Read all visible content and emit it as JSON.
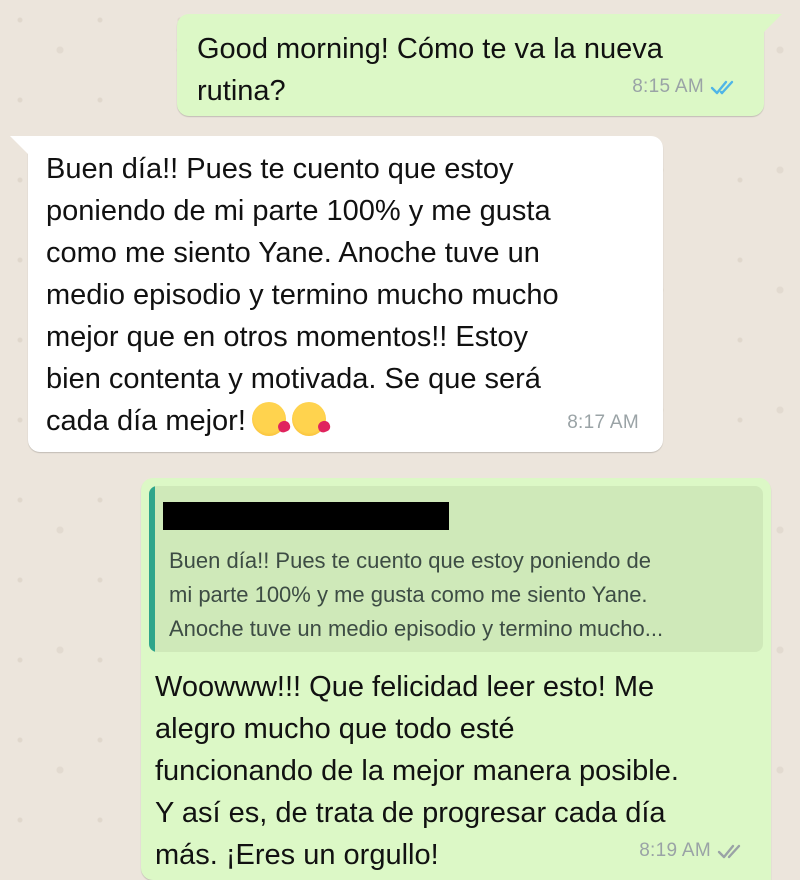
{
  "chat": {
    "messages": [
      {
        "direction": "outgoing",
        "text": "Good morning! Cómo te va la nueva\nrutina?",
        "time": "8:15 AM",
        "status_icon": "double-check-read-icon",
        "status_color": "#4fb5e7"
      },
      {
        "direction": "incoming",
        "text": "Buen día!! Pues te cuento que estoy\nponiendo de mi parte 100% y me gusta\ncomo me siento Yane. Anoche tuve un\nmedio episodio y termino mucho mucho\nmejor que en otros momentos!! Estoy\nbien contenta y motivada. Se que será\ncada día mejor!",
        "emoji_icons": [
          "face-blowing-kiss-icon",
          "face-blowing-kiss-icon"
        ],
        "time": "8:17 AM"
      },
      {
        "direction": "outgoing",
        "quote": {
          "author_redacted": true,
          "text": "Buen día!! Pues te cuento que estoy poniendo de\nmi parte 100% y me gusta como me siento Yane.\nAnoche tuve un medio episodio y termino mucho..."
        },
        "text": "Woowww!!! Que felicidad leer esto! Me\nalegro mucho que todo esté\nfuncionando de la mejor manera posible.\nY así es, de trata de progresar cada día\nmás. ¡Eres un orgullo!",
        "time": "8:19 AM",
        "status_icon": "double-check-delivered-icon",
        "status_color": "#9aa3a6"
      }
    ]
  },
  "colors": {
    "outgoing_bubble": "#dcf8c6",
    "incoming_bubble": "#ffffff",
    "quote_bar": "#2fa58b",
    "wallpaper": "#ece5dc"
  }
}
